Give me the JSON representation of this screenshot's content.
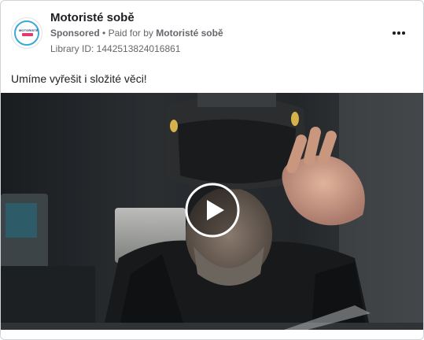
{
  "ad": {
    "page_name": "Motoristé sobě",
    "sponsored_label": "Sponsored",
    "separator": "•",
    "paid_for_prefix": "Paid for by",
    "paid_for_name": "Motoristé sobě",
    "library_id": "Library ID: 1442513824016861",
    "body_text": "Umíme vyřešit i složité věci!",
    "avatar_text": "MOTORISTÉ"
  },
  "icons": {
    "more": "more-horizontal-icon",
    "play": "play-icon"
  },
  "colors": {
    "avatar_ring": "#3aa8d8",
    "avatar_accent": "#e5386f",
    "secondary_text": "#65676b",
    "primary_text": "#1c1e21"
  }
}
